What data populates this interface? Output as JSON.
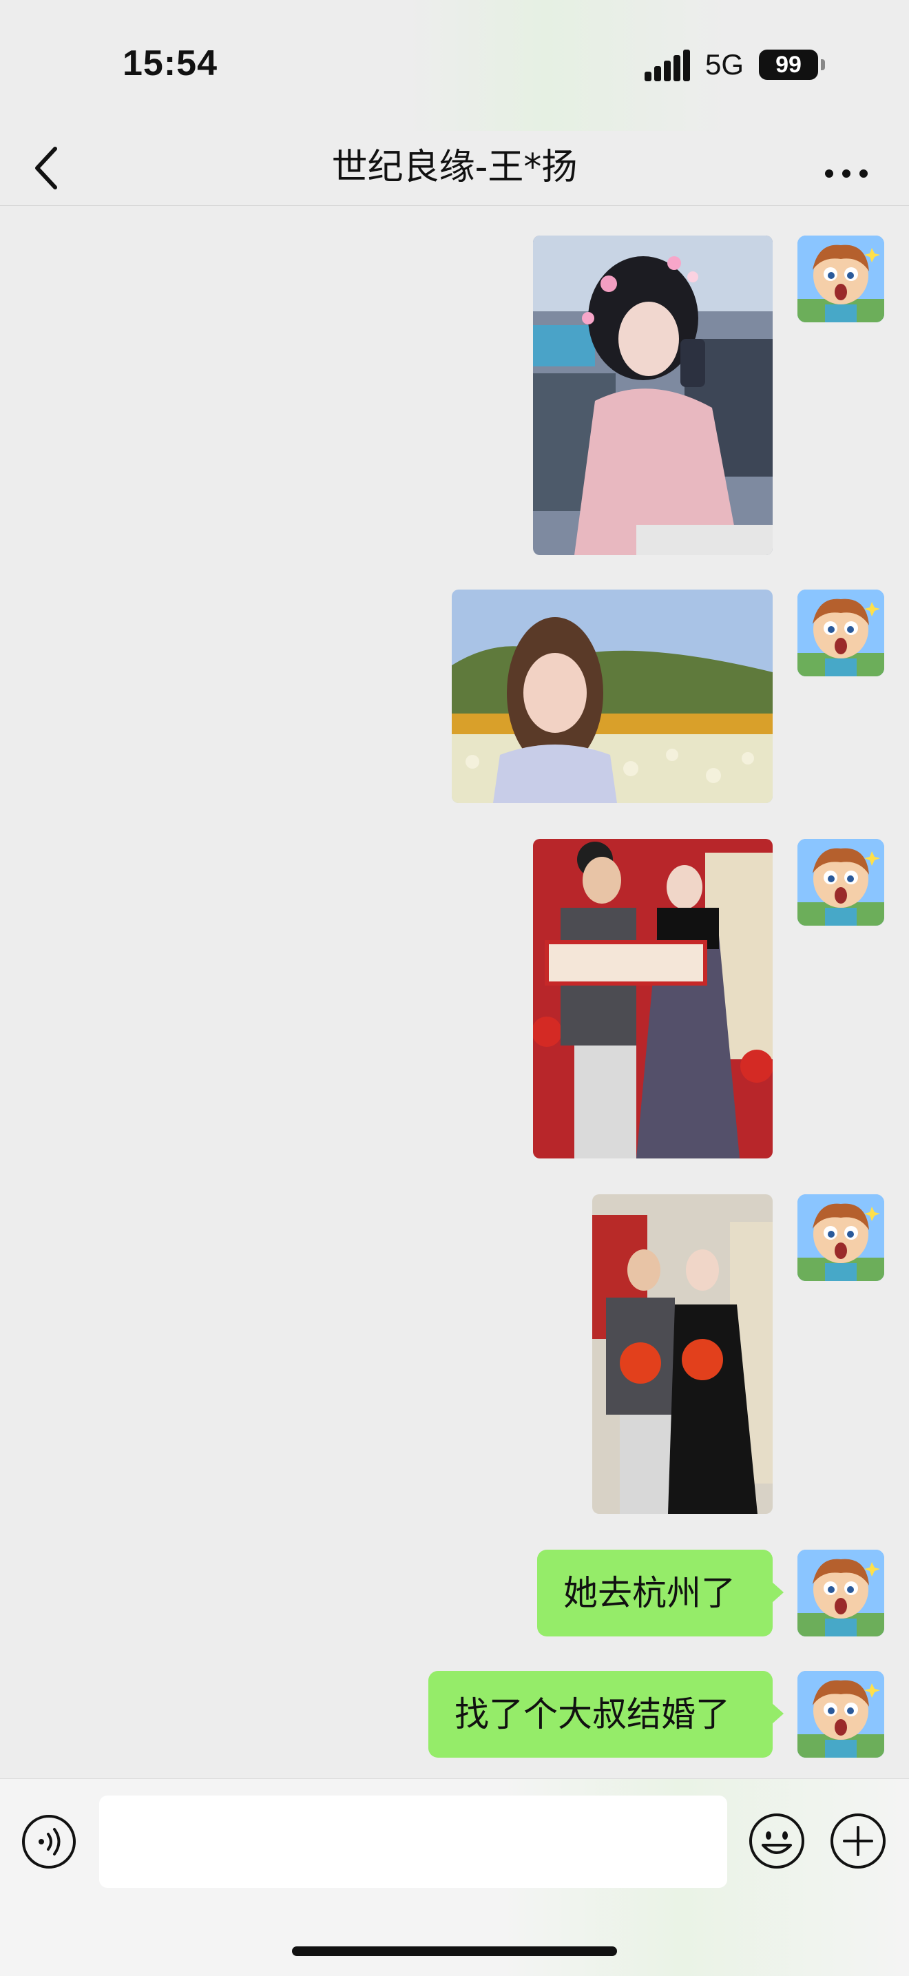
{
  "status_bar": {
    "time": "15:54",
    "network": "5G",
    "battery": "99"
  },
  "header": {
    "title": "世纪良缘-王*扬",
    "back_icon": "chevron-left-icon",
    "more_icon": "more-dots-icon"
  },
  "messages": [
    {
      "type": "image",
      "description_icon": "photo-hanfu-girl"
    },
    {
      "type": "image",
      "description_icon": "photo-tulip-field-girl"
    },
    {
      "type": "image",
      "description_icon": "photo-couple-red-banner"
    },
    {
      "type": "image",
      "description_icon": "photo-couple-lanterns"
    },
    {
      "type": "text",
      "text": "她去杭州了"
    },
    {
      "type": "text",
      "text": "找了个大叔结婚了"
    }
  ],
  "input_bar": {
    "voice_icon": "voice-icon",
    "emoji_icon": "emoji-icon",
    "plus_icon": "plus-icon",
    "value": ""
  },
  "colors": {
    "bubble": "#95ec69",
    "background": "#ededed"
  }
}
